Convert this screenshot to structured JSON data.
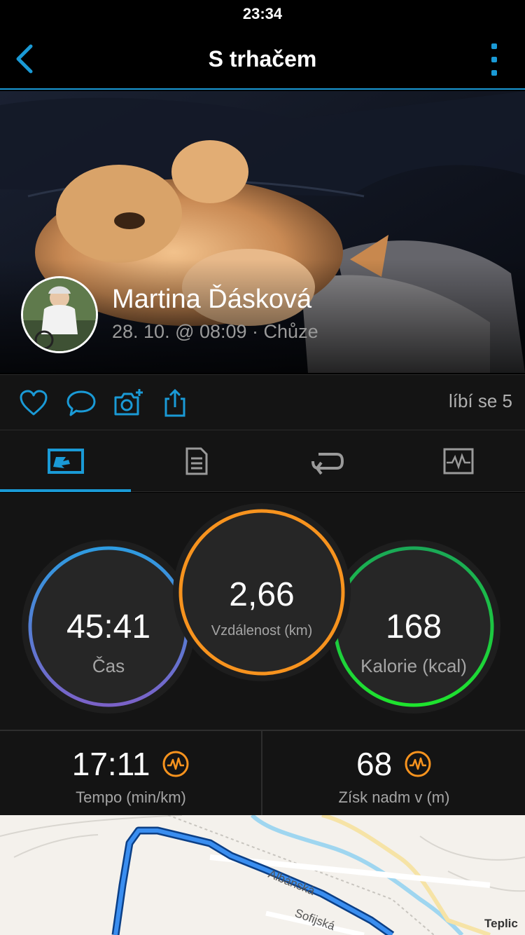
{
  "status_bar": {
    "time": "23:34"
  },
  "nav": {
    "title": "S trhačem"
  },
  "activity": {
    "user_name": "Martina Ďásková",
    "meta": "28. 10. @ 08:09 · Chůze"
  },
  "actions": {
    "likes": "líbí se 5"
  },
  "tabs": [
    {
      "icon": "stats-icon",
      "active": true
    },
    {
      "icon": "details-icon",
      "active": false
    },
    {
      "icon": "laps-icon",
      "active": false
    },
    {
      "icon": "chart-icon",
      "active": false
    }
  ],
  "stats": {
    "time": {
      "value": "45:41",
      "label": "Čas"
    },
    "distance": {
      "value": "2,66",
      "label": "Vzdálenost (km)"
    },
    "calories": {
      "value": "168",
      "label": "Kalorie (kcal)"
    }
  },
  "metrics": {
    "pace": {
      "value": "17:11",
      "label": "Tempo (min/km)"
    },
    "elevation": {
      "value": "68",
      "label": "Získ nadm v (m)"
    }
  },
  "map": {
    "street1": "Albánská",
    "street2": "Sofijská",
    "street3": "Teplic"
  },
  "colors": {
    "accent": "#1a9ad6",
    "time_ring": "#4a90d9",
    "distance_ring": "#f7931e",
    "calories_ring": "#19d64b",
    "route": "#2f7fe0"
  }
}
